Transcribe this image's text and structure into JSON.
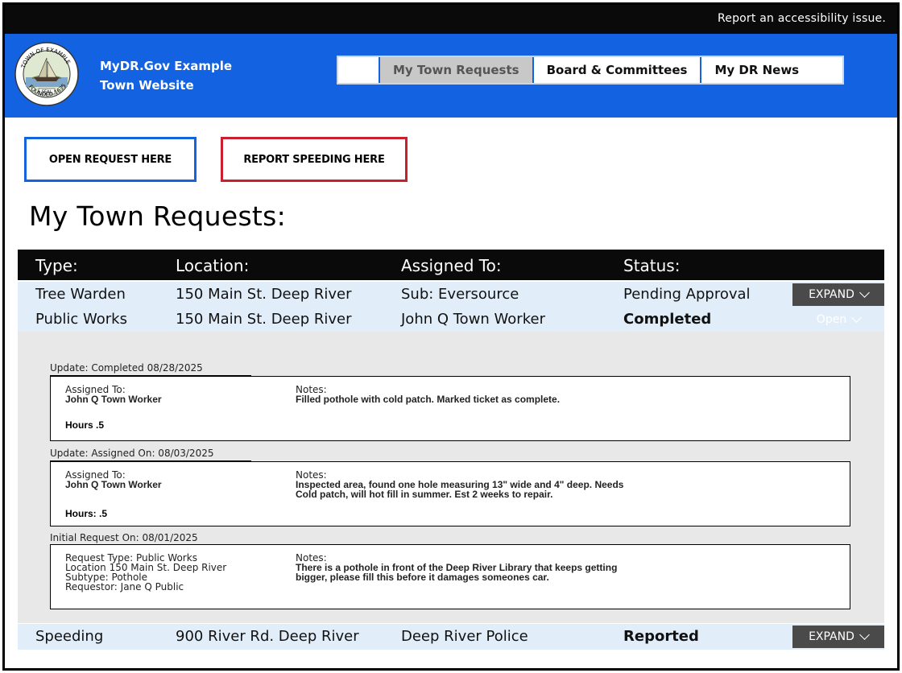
{
  "topbar": {
    "accessibility_link": "Report an accessibility issue."
  },
  "header": {
    "site_name_line1": "MyDR.Gov Example",
    "site_name_line2": "Town Website",
    "seal_text": "TOWN OF EXAMPLE · SEAL · FOUNDED 1635"
  },
  "nav": {
    "items": [
      "My Town Requests",
      "Board & Committees",
      "My DR News"
    ],
    "active": "My Town Requests"
  },
  "actions": {
    "open_request": "OPEN REQUEST HERE",
    "report_speeding": "REPORT SPEEDING HERE"
  },
  "page": {
    "title": "My Town Requests:"
  },
  "table": {
    "headers": {
      "type": "Type:",
      "location": "Location:",
      "assigned": "Assigned To:",
      "status": "Status:"
    },
    "rows": [
      {
        "type": "Tree Warden",
        "location": "150 Main St. Deep River",
        "assigned": "Sub: Eversource",
        "status": "Pending Approval",
        "status_color": "#f5a623",
        "action": "EXPAND"
      },
      {
        "type": "Public Works",
        "location": "150 Main St. Deep River",
        "assigned": "John Q Town Worker",
        "status": "Completed",
        "status_color": "#148a1c",
        "action": "Open"
      },
      {
        "type": "Speeding",
        "location": "900 River Rd. Deep River",
        "assigned": "Deep River Police",
        "status": "Reported",
        "status_color": "#d41f2a",
        "action": "EXPAND"
      }
    ]
  },
  "updates": [
    {
      "label": "Update: Completed 08/28/2025",
      "left_title": "Assigned To:",
      "left_value": "John Q Town Worker",
      "hours": "Hours .5",
      "notes_title": "Notes:",
      "notes_line1": "Filled pothole with cold patch. Marked ticket as complete.",
      "notes_line2": ""
    },
    {
      "label": "Update: Assigned On: 08/03/2025",
      "left_title": "Assigned To:",
      "left_value": "John Q Town Worker",
      "hours": "Hours: .5",
      "notes_title": "Notes:",
      "notes_line1": "Inspected area, found one hole measuring 13\" wide and 4\" deep. Needs",
      "notes_line2": "Cold patch, will hot fill in summer. Est 2 weeks to repair."
    },
    {
      "label": "Initial Request On: 08/01/2025",
      "left_lines": [
        "Request Type: Public Works",
        "Location 150 Main St. Deep River",
        "Subtype: Pothole",
        "Requestor: Jane Q Public"
      ],
      "notes_title": "Notes:",
      "notes_line1": "There is a pothole in front of the Deep River Library that keeps getting",
      "notes_line2": "bigger, please fill this before it damages someones car."
    }
  ],
  "colors": {
    "header_blue": "#1262e2",
    "open_border": "#1464dc",
    "speed_border": "#c8202e",
    "row_bg": "#e1eefa"
  }
}
